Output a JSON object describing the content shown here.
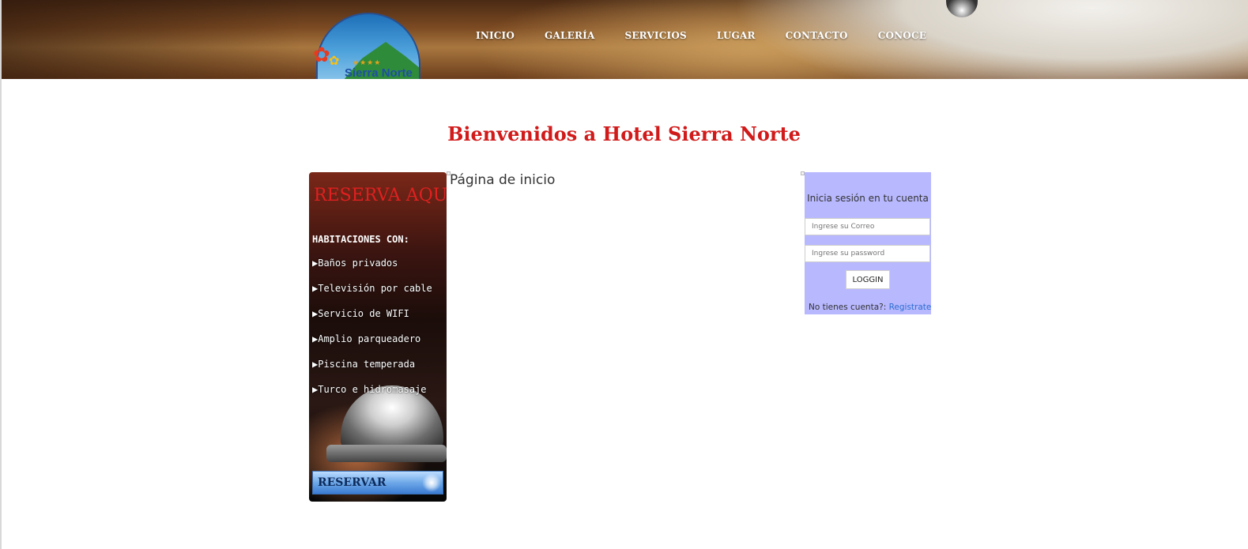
{
  "header": {
    "logo_text": "Sierra Norte",
    "logo_stars": "★★★★",
    "nav": [
      {
        "label": "INICIO"
      },
      {
        "label": "GALERÍA"
      },
      {
        "label": "SERVICIOS"
      },
      {
        "label": "LUGAR"
      },
      {
        "label": "CONTACTO"
      },
      {
        "label": "CONOCE"
      }
    ]
  },
  "welcome": "Bienvenidos a Hotel Sierra Norte",
  "reserva": {
    "title": "RESERVA AQUI",
    "heading": "HABITACIONES CON:",
    "items": [
      "▶Baños privados",
      "▶Televisión por cable",
      "▶Servicio de WIFI",
      "▶Amplio parqueadero",
      "▶Piscina temperada",
      "▶Turco e hidromasaje"
    ],
    "button_label": "RESERVAR"
  },
  "content": {
    "title": "Página de inicio"
  },
  "login": {
    "title": "Inicia sesión en tu cuenta",
    "email_placeholder": "Ingrese su Correo",
    "password_placeholder": "Ingrese su password",
    "button_label": "LOGGIN",
    "footer_text": "No tienes cuenta?: ",
    "register_link": "Registrate"
  },
  "colors": {
    "welcome_red": "#d11a1a",
    "login_bg": "#b8b8ff",
    "link_blue": "#2a6fd1"
  }
}
